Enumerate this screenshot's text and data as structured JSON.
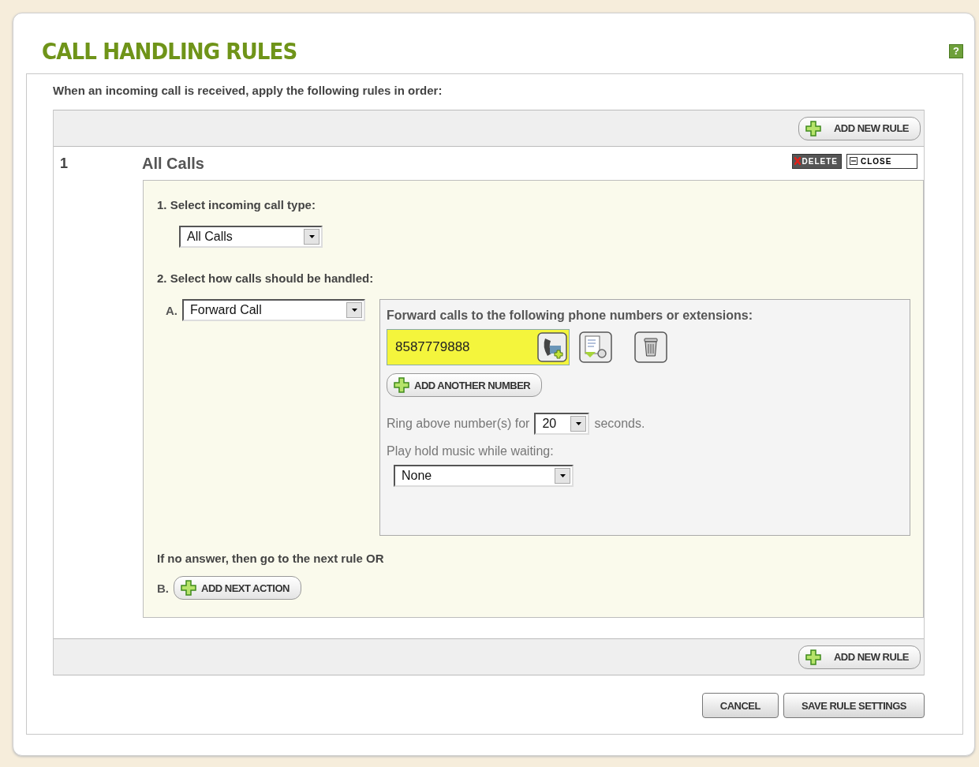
{
  "title": "CALL HANDLING RULES",
  "help": "?",
  "intro": "When an incoming call is received, apply the following rules in order:",
  "add_rule_top": "ADD NEW RULE",
  "rule": {
    "number": "1",
    "name": "All Calls",
    "delete": "DELETE",
    "close": "CLOSE",
    "step1_label": "1. Select incoming call type:",
    "call_type": "All Calls",
    "step2_label": "2. Select how calls should be handled:",
    "action_letter": "A.",
    "action": "Forward Call",
    "forward_label": "Forward calls to the following phone numbers or extensions:",
    "numbers": [
      {
        "value": "8587779888",
        "highlighted": true
      }
    ],
    "add_number": "ADD ANOTHER NUMBER",
    "ring_prefix": "Ring above number(s) for",
    "ring_seconds": "20",
    "ring_suffix": "seconds.",
    "hold_label": "Play hold music while waiting:",
    "hold_music": "None",
    "no_answer": "If no answer, then go to the next rule OR",
    "next_letter": "B.",
    "add_next": "ADD NEXT ACTION"
  },
  "add_rule_bottom": "ADD NEW RULE",
  "buttons": [
    "CANCEL",
    "SAVE RULE SETTINGS"
  ]
}
